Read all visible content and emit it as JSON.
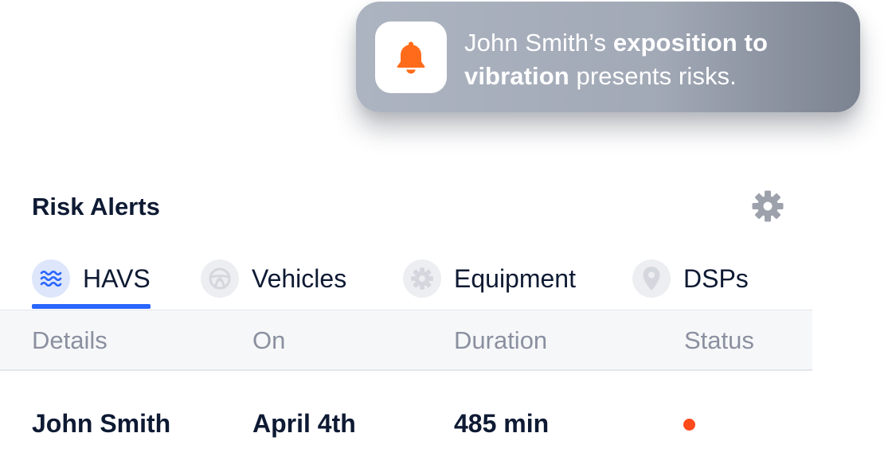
{
  "notification": {
    "icon": "bell-icon",
    "icon_color": "#ff6b1a",
    "text_prefix": "John Smith’s ",
    "text_bold": "exposition to vibration",
    "text_suffix": " presents risks."
  },
  "panel": {
    "title": "Risk Alerts",
    "settings_icon": "gear-icon"
  },
  "tabs": [
    {
      "label": "HAVS",
      "icon": "vibration-waves-icon",
      "active": true
    },
    {
      "label": "Vehicles",
      "icon": "steering-wheel-icon",
      "active": false
    },
    {
      "label": "Equipment",
      "icon": "gear-icon",
      "active": false
    },
    {
      "label": "DSPs",
      "icon": "location-pin-icon",
      "active": false
    }
  ],
  "table": {
    "columns": [
      "Details",
      "On",
      "Duration",
      "Status"
    ],
    "rows": [
      {
        "details": "John Smith",
        "on": "April 4th",
        "duration": "485 min",
        "status_color": "#ff4a1c"
      }
    ]
  },
  "colors": {
    "accent": "#2a66ff",
    "alert": "#ff4a1c",
    "text_dark": "#0e1a33",
    "text_muted": "#8a90a0"
  }
}
